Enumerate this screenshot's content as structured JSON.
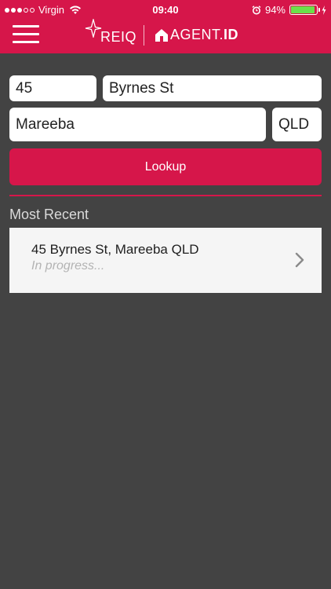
{
  "status_bar": {
    "carrier": "Virgin",
    "time": "09:40",
    "battery_percent": "94%",
    "battery_level": 0.94,
    "icons": [
      "signal-dots-icon",
      "wifi-icon",
      "alarm-icon",
      "battery-icon",
      "charging-icon"
    ]
  },
  "header": {
    "logo_left_text": "REIQ",
    "logo_right_prefix": "AGENT.",
    "logo_right_suffix": "ID",
    "menu_icon": "hamburger-menu-icon"
  },
  "form": {
    "street_number": "45",
    "street_name": "Byrnes St",
    "suburb": "Mareeba",
    "state": "QLD",
    "lookup_label": "Lookup"
  },
  "recent": {
    "title": "Most Recent",
    "items": [
      {
        "address": "45 Byrnes St, Mareeba QLD",
        "status": "In progress..."
      }
    ]
  },
  "colors": {
    "brand": "#d6164a",
    "background": "#434343",
    "card": "#f5f5f5",
    "battery": "#6be04a"
  }
}
